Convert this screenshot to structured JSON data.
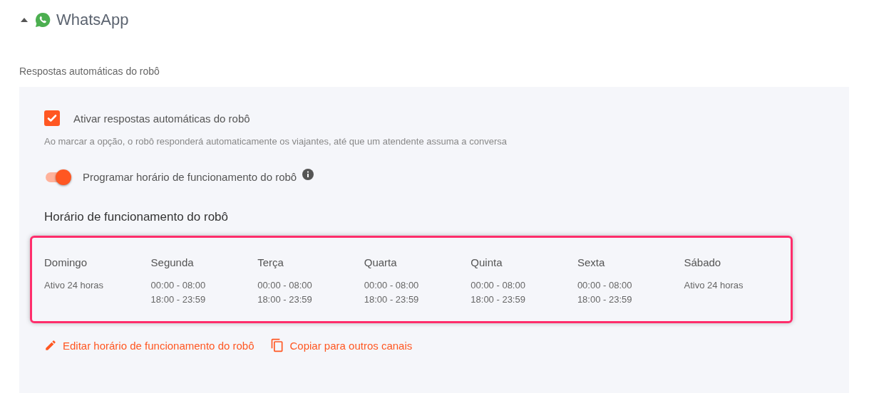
{
  "section": {
    "title": "WhatsApp",
    "expanded": true
  },
  "subtitle": "Respostas automáticas do robô",
  "auto_reply": {
    "label": "Ativar respostas automáticas do robô",
    "checked": true
  },
  "description": "Ao marcar a opção, o robô responderá automaticamente os viajantes, até que um atendente assuma a conversa",
  "schedule_toggle": {
    "label": "Programar horário de funcionamento do robô",
    "on": true
  },
  "schedule": {
    "title": "Horário de funcionamento do robô",
    "highlighted": true,
    "days": [
      {
        "name": "Domingo",
        "hours": [
          "Ativo 24 horas"
        ]
      },
      {
        "name": "Segunda",
        "hours": [
          "00:00 - 08:00",
          "18:00 - 23:59"
        ]
      },
      {
        "name": "Terça",
        "hours": [
          "00:00 - 08:00",
          "18:00 - 23:59"
        ]
      },
      {
        "name": "Quarta",
        "hours": [
          "00:00 - 08:00",
          "18:00 - 23:59"
        ]
      },
      {
        "name": "Quinta",
        "hours": [
          "00:00 - 08:00",
          "18:00 - 23:59"
        ]
      },
      {
        "name": "Sexta",
        "hours": [
          "00:00 - 08:00",
          "18:00 - 23:59"
        ]
      },
      {
        "name": "Sábado",
        "hours": [
          "Ativo 24 horas"
        ]
      }
    ]
  },
  "actions": [
    {
      "kind": "edit",
      "label": "Editar horário de funcionamento do robô"
    },
    {
      "kind": "copy",
      "label": "Copiar para outros canais"
    }
  ]
}
